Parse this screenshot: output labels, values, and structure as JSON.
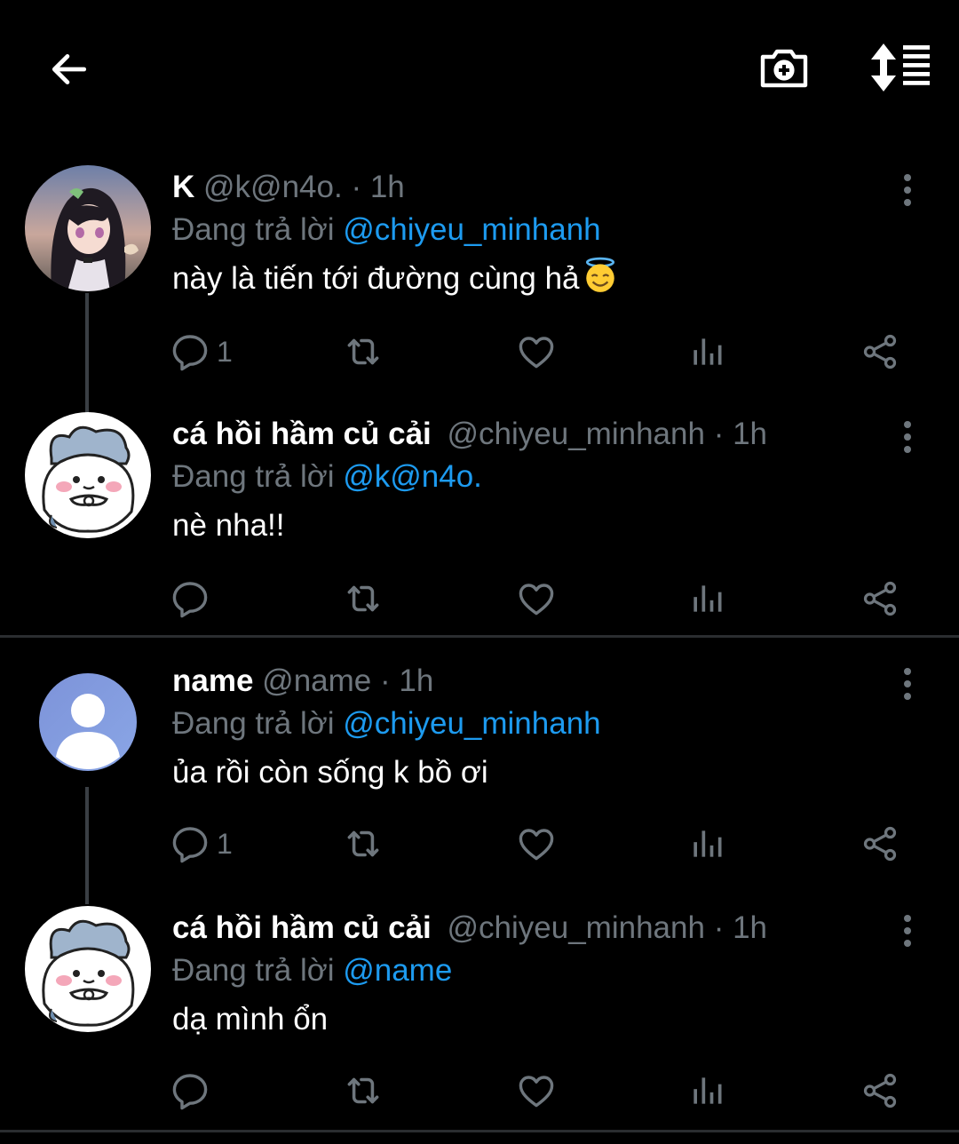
{
  "header": {
    "back_icon": "arrow-left-icon",
    "camera_icon": "camera-plus-icon",
    "sort_icon": "sort-list-icon"
  },
  "colors": {
    "background": "#000000",
    "mention": "#1d9bf0",
    "muted": "#6e767d",
    "thread_line": "#3a3f44"
  },
  "tweets": [
    {
      "name": "K",
      "handle": "@k@n4o.",
      "dot": "·",
      "time": "1h",
      "reply_prefix": "Đang trả lời",
      "reply_to": "@chiyeu_minhanh",
      "text": "này là tiến tới đường cùng hả",
      "emoji": "smiling-face-with-halo",
      "reply_count": "1",
      "avatar": "anime-girl-avatar"
    },
    {
      "name": "cá hồi hầm củ cải",
      "handle": "@chiyeu_minhanh",
      "dot": "·",
      "time": "1h",
      "reply_prefix": "Đang trả lời",
      "reply_to": "@k@n4o.",
      "text": "nè nha!!",
      "reply_count": "",
      "avatar": "chiikawa-avatar"
    },
    {
      "name": "name",
      "handle": "@name",
      "dot": "·",
      "time": "1h",
      "reply_prefix": "Đang trả lời",
      "reply_to": "@chiyeu_minhanh",
      "text": "ủa rồi còn sống k bồ ơi",
      "reply_count": "1",
      "avatar": "default-user-avatar"
    },
    {
      "name": "cá hồi hầm củ cải",
      "handle": "@chiyeu_minhanh",
      "dot": "·",
      "time": "1h",
      "reply_prefix": "Đang trả lời",
      "reply_to": "@name",
      "text": "dạ mình ổn",
      "reply_count": "",
      "avatar": "chiikawa-avatar"
    }
  ]
}
